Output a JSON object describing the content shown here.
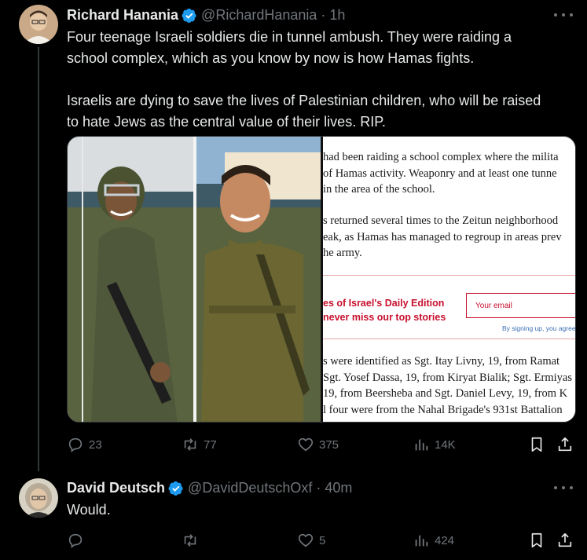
{
  "tweet1": {
    "author_name": "Richard Hanania",
    "handle": "@RichardHanania",
    "separator": "·",
    "time": "1h",
    "paragraph1_line1": "Four teenage Israeli soldiers die in tunnel ambush. They were raiding a",
    "paragraph1_line2": "school complex, which as you know by now is how Hamas fights.",
    "paragraph2_line1": "Israelis are dying to save the lives of Palestinian children, who will be raised",
    "paragraph2_line2": "to hate Jews as the central value of their lives. RIP.",
    "article": {
      "lines_top": [
        "had been raiding a school complex where the milita",
        "of Hamas activity. Weaponry and at least one tunne",
        "in the area of the school."
      ],
      "lines_mid": [
        "s returned several times to the Zeitun neighborhood",
        "eak, as Hamas has managed to regroup in areas prev",
        "he army."
      ],
      "promo_line1": "es of Israel's Daily Edition",
      "promo_line2": "never miss our top stories",
      "email_placeholder": "Your email",
      "signup_note": "By signing up, you agree to t",
      "lines_bottom": [
        "s were identified as Sgt. Itay Livny, 19, from Ramat",
        "Sgt. Yosef Dassa, 19, from Kiryat Bialik;  Sgt. Ermiyas",
        " 19, from Beersheba and Sgt. Daniel Levy, 19, from K",
        "l four were from the  Nahal Brigade's 931st Battalion"
      ]
    },
    "replies": "23",
    "reposts": "77",
    "likes": "375",
    "views": "14K"
  },
  "tweet2": {
    "author_name": "David Deutsch",
    "handle": "@DavidDeutschOxf",
    "separator": "·",
    "time": "40m",
    "text": "Would.",
    "replies": "",
    "reposts": "",
    "likes": "5",
    "views": "424"
  },
  "colors": {
    "background": "#000000",
    "text": "#e7e9ea",
    "secondary": "#71767b",
    "verified": "#1d9bf0",
    "article_accent": "#c8102e"
  },
  "icons": [
    "verified-badge-icon",
    "reply-icon",
    "repost-icon",
    "like-icon",
    "views-icon",
    "bookmark-icon",
    "share-icon",
    "more-icon"
  ]
}
